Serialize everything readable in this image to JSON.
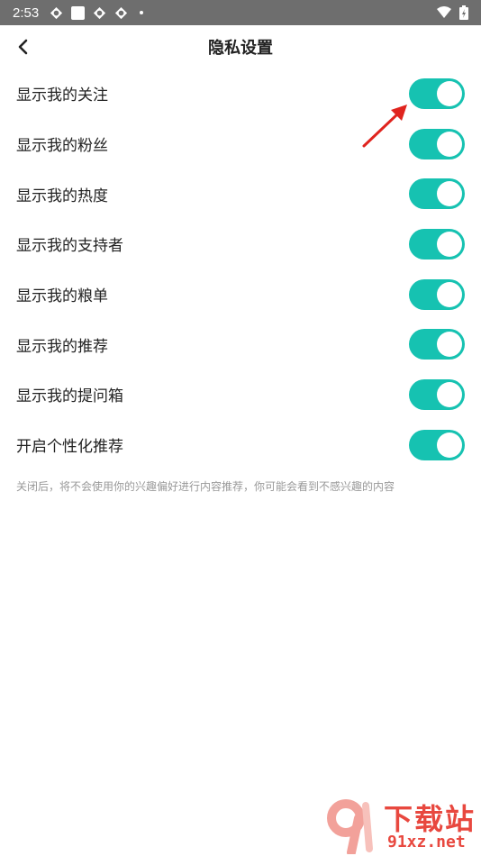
{
  "status_bar": {
    "time": "2:53",
    "icons": [
      "diamond-icon",
      "square-icon",
      "diamond-icon",
      "diamond-icon",
      "dot-icon"
    ],
    "right_icons": [
      "wifi-icon",
      "battery-icon"
    ]
  },
  "header": {
    "title": "隐私设置",
    "back_icon": "chevron-left-icon"
  },
  "settings": [
    {
      "label": "显示我的关注",
      "enabled": true
    },
    {
      "label": "显示我的粉丝",
      "enabled": true
    },
    {
      "label": "显示我的热度",
      "enabled": true
    },
    {
      "label": "显示我的支持者",
      "enabled": true
    },
    {
      "label": "显示我的粮单",
      "enabled": true
    },
    {
      "label": "显示我的推荐",
      "enabled": true
    },
    {
      "label": "显示我的提问箱",
      "enabled": true
    },
    {
      "label": "开启个性化推荐",
      "enabled": true
    }
  ],
  "note": "关闭后，将不会使用你的兴趣偏好进行内容推荐，你可能会看到不感兴趣的内容",
  "colors": {
    "toggle_on": "#16c2b1",
    "status_bar": "#6e6e6e",
    "annotation_arrow": "#e0241e",
    "watermark": "#e8483f"
  },
  "watermark": {
    "text_top": "下载站",
    "text_bottom": "91xz.net"
  }
}
